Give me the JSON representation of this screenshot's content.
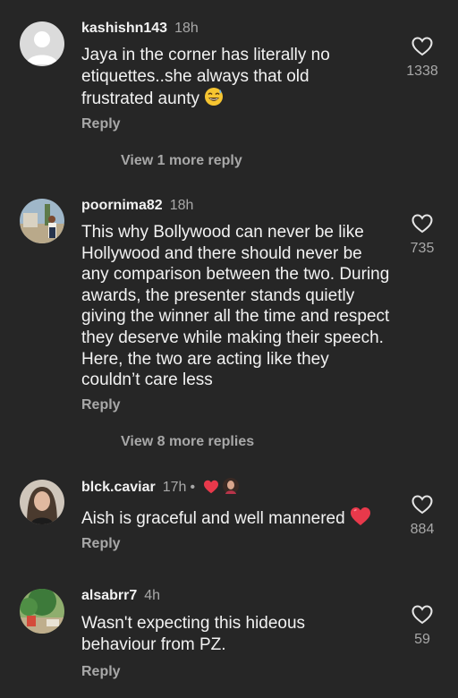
{
  "comments": [
    {
      "username": "kashishn143",
      "time": "18h",
      "text": "Jaya in the corner has literally no etiquettes..she always that old frustrated aunty",
      "likes": "1338",
      "reply_label": "Reply",
      "view_more": "View 1 more reply",
      "avatar_icon": "default-user-avatar",
      "trailing_emoji": "grinning-sweat-emoji"
    },
    {
      "username": "poornima82",
      "time": "18h",
      "text": "This why Bollywood can never be like Hollywood and there should never be any comparison between the two. During awards, the presenter stands quietly giving the winner all the time and respect they deserve while making their speech. Here, the two are acting like they couldn’t care less",
      "likes": "735",
      "reply_label": "Reply",
      "view_more": "View 8 more replies",
      "avatar_icon": "photo-avatar"
    },
    {
      "username": "blck.caviar",
      "time": "17h",
      "text": "Aish is graceful and well mannered",
      "likes": "884",
      "reply_label": "Reply",
      "avatar_icon": "photo-avatar",
      "badge_icons": [
        "red-heart-icon",
        "creator-avatar-icon"
      ],
      "trailing_emoji": "red-heart-emoji"
    },
    {
      "username": "alsabrr7",
      "time": "4h",
      "text": "Wasn't expecting this hideous behaviour from PZ.",
      "likes": "59",
      "reply_label": "Reply",
      "avatar_icon": "photo-avatar"
    }
  ],
  "colors": {
    "background": "#262626",
    "primary_text": "#f2f2f2",
    "secondary_text": "#a8a8a8",
    "heart_red": "#e8394b"
  }
}
